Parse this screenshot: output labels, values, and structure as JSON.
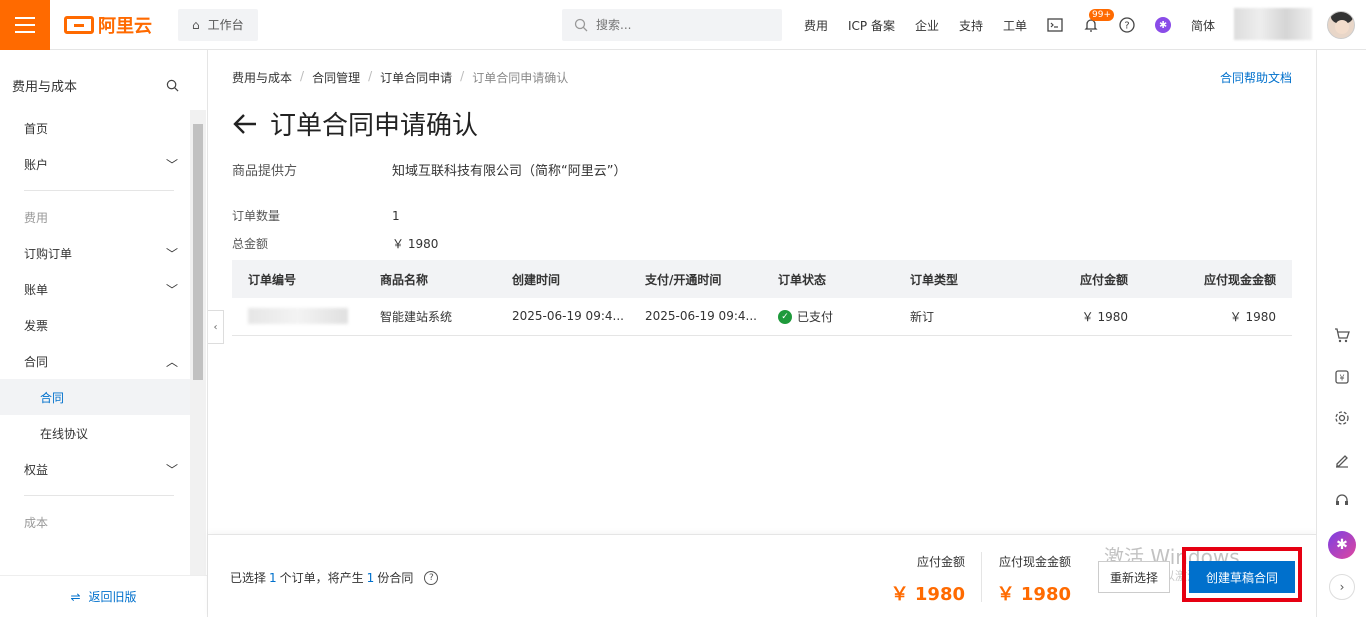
{
  "topbar": {
    "logo_text": "阿里云",
    "workbench": "工作台",
    "search_placeholder": "搜索...",
    "nav": [
      "费用",
      "ICP 备案",
      "企业",
      "支持",
      "工单"
    ],
    "notification_badge": "99+",
    "language": "简体"
  },
  "sidebar": {
    "title": "费用与成本",
    "items": {
      "home": "首页",
      "account": "账户",
      "group_fee": "费用",
      "orders": "订购订单",
      "bills": "账单",
      "invoice": "发票",
      "contract": "合同",
      "contract_sub": "合同",
      "online_agreement": "在线协议",
      "benefits": "权益",
      "group_cost": "成本"
    },
    "back_old": "返回旧版"
  },
  "breadcrumb": [
    "费用与成本",
    "合同管理",
    "订单合同申请",
    "订单合同申请确认"
  ],
  "help_link": "合同帮助文档",
  "page_title": "订单合同申请确认",
  "provider": {
    "label": "商品提供方",
    "value": "知域互联科技有限公司（简称“阿里云”）"
  },
  "order_count": {
    "label": "订单数量",
    "value": "1"
  },
  "total_amount": {
    "label": "总金额",
    "value": "￥ 1980"
  },
  "table": {
    "headers": [
      "订单编号",
      "商品名称",
      "创建时间",
      "支付/开通时间",
      "订单状态",
      "订单类型",
      "应付金额",
      "应付现金金额"
    ],
    "rows": [
      {
        "product": "智能建站系统",
        "created": "2025-06-19 09:4...",
        "paid_time": "2025-06-19 09:4...",
        "status": "已支付",
        "type": "新订",
        "payable": "￥ 1980",
        "cash_payable": "￥ 1980"
      }
    ]
  },
  "footer": {
    "sel_prefix": "已选择",
    "sel_count": "1",
    "sel_mid": "个订单，将产生",
    "contract_count": "1",
    "sel_suffix": "份合同",
    "payable_label": "应付金额",
    "payable_value": "￥ 1980",
    "cash_label": "应付现金金额",
    "cash_value": "￥ 1980",
    "reset_button": "重新选择",
    "create_button": "创建草稿合同",
    "watermark_line1": "激活 Windows",
    "watermark_line2": "转到\"设置\"以激活 Windows。"
  },
  "colors": {
    "brand_orange": "#ff6a00",
    "link_blue": "#0070cc",
    "highlight_red": "#e60012",
    "paid_green": "#1e9a3b"
  }
}
